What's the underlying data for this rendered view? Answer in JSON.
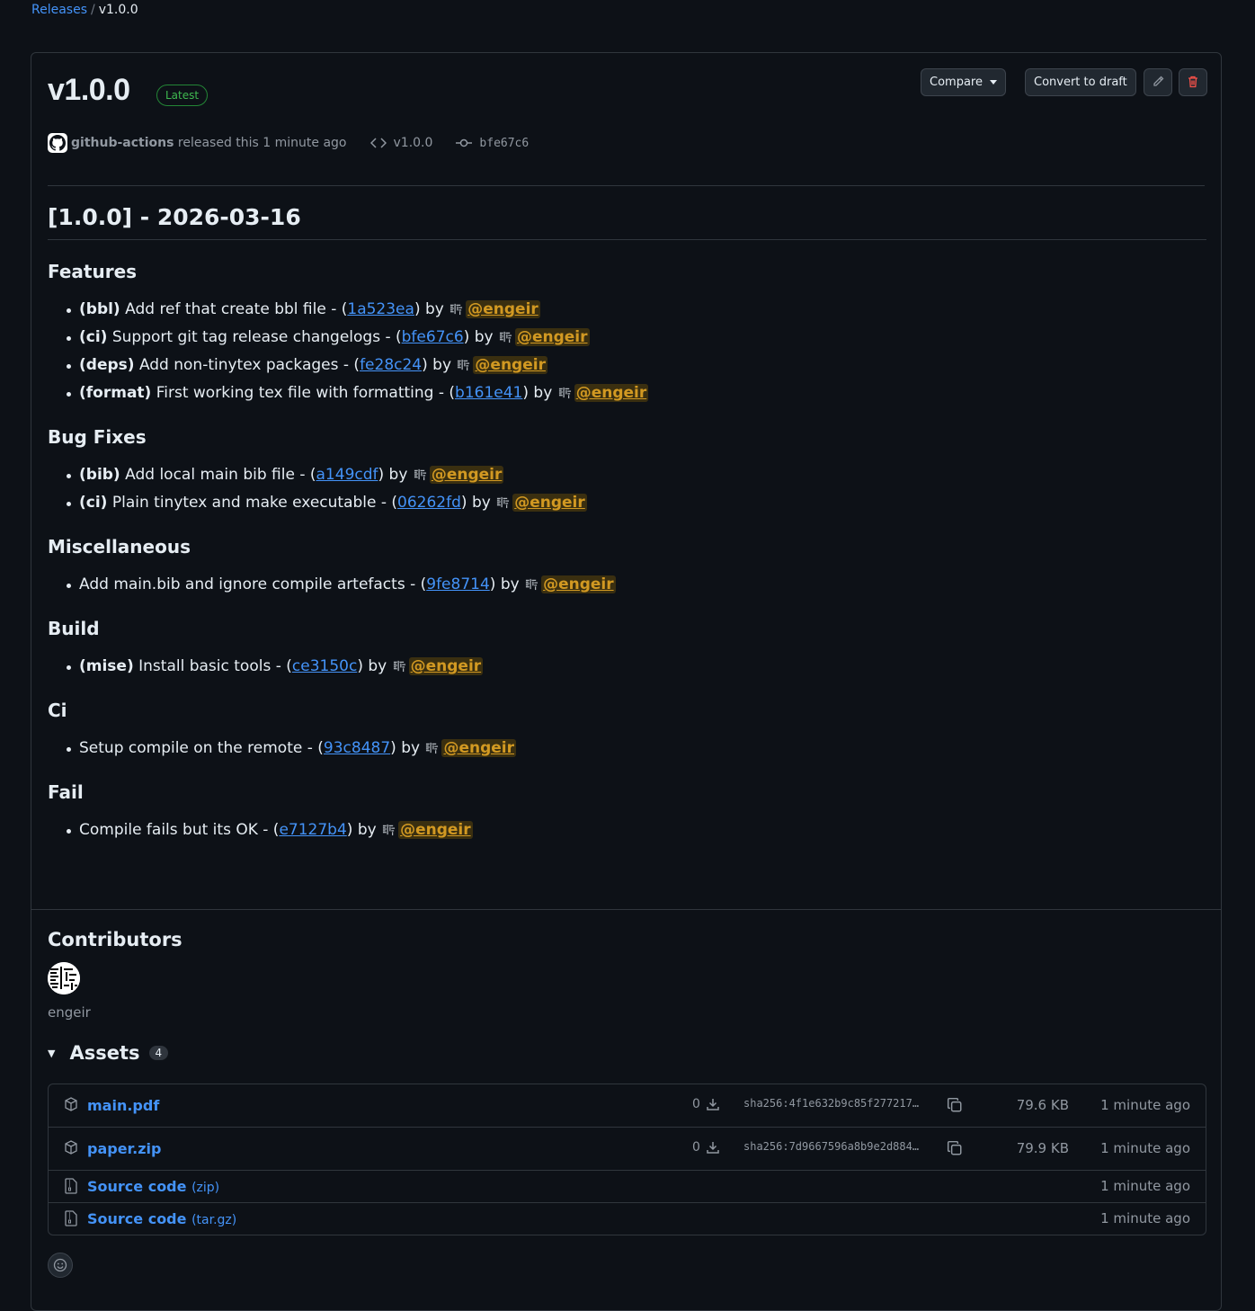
{
  "breadcrumb": {
    "parent": "Releases",
    "separator": "/",
    "current": "v1.0.0"
  },
  "release": {
    "title": "v1.0.0",
    "badge": "Latest",
    "author": "github-actions",
    "released_text": "released this 1 minute ago",
    "tag": "v1.0.0",
    "commit": "bfe67c6",
    "actions": {
      "compare": "Compare",
      "convert": "Convert to draft",
      "edit_icon": "pencil-icon",
      "delete_icon": "trash-icon"
    }
  },
  "notes": {
    "heading": "[1.0.0] - 2026-03-16",
    "sections": [
      {
        "title": "Features",
        "items": [
          {
            "scope": "(bbl)",
            "text": "Add ref that create bbl file - (",
            "sha": "1a523ea",
            "by": ") by",
            "user": "@engeir"
          },
          {
            "scope": "(ci)",
            "text": "Support git tag release changelogs - (",
            "sha": "bfe67c6",
            "by": ") by",
            "user": "@engeir"
          },
          {
            "scope": "(deps)",
            "text": "Add non-tinytex packages - (",
            "sha": "fe28c24",
            "by": ") by",
            "user": "@engeir"
          },
          {
            "scope": "(format)",
            "text": "First working tex file with formatting - (",
            "sha": "b161e41",
            "by": ") by",
            "user": "@engeir"
          }
        ]
      },
      {
        "title": "Bug Fixes",
        "items": [
          {
            "scope": "(bib)",
            "text": "Add local main bib file - (",
            "sha": "a149cdf",
            "by": ") by",
            "user": "@engeir"
          },
          {
            "scope": "(ci)",
            "text": "Plain tinytex and make executable - (",
            "sha": "06262fd",
            "by": ") by",
            "user": "@engeir"
          }
        ]
      },
      {
        "title": "Miscellaneous",
        "items": [
          {
            "scope": "",
            "text": "Add main.bib and ignore compile artefacts - (",
            "sha": "9fe8714",
            "by": ") by",
            "user": "@engeir"
          }
        ]
      },
      {
        "title": "Build",
        "items": [
          {
            "scope": "(mise)",
            "text": "Install basic tools - (",
            "sha": "ce3150c",
            "by": ") by",
            "user": "@engeir"
          }
        ]
      },
      {
        "title": "Ci",
        "items": [
          {
            "scope": "",
            "text": "Setup compile on the remote - (",
            "sha": "93c8487",
            "by": ") by",
            "user": "@engeir"
          }
        ]
      },
      {
        "title": "Fail",
        "items": [
          {
            "scope": "",
            "text": "Compile fails but its OK - (",
            "sha": "e7127b4",
            "by": ") by",
            "user": "@engeir"
          }
        ]
      }
    ]
  },
  "contributors": {
    "title": "Contributors",
    "names": [
      "engeir"
    ]
  },
  "assets": {
    "title": "Assets",
    "count": "4",
    "files": [
      {
        "name": "main.pdf",
        "downloads": "0",
        "sha": "sha256:4f1e632b9c85f277217…",
        "size": "79.6 KB",
        "when": "1 minute ago"
      },
      {
        "name": "paper.zip",
        "downloads": "0",
        "sha": "sha256:7d9667596a8b9e2d884…",
        "size": "79.9 KB",
        "when": "1 minute ago"
      }
    ],
    "sources": [
      {
        "name": "Source code",
        "ext": "(zip)",
        "when": "1 minute ago"
      },
      {
        "name": "Source code",
        "ext": "(tar.gz)",
        "when": "1 minute ago"
      }
    ]
  },
  "reaction_icon": "smiley-icon"
}
